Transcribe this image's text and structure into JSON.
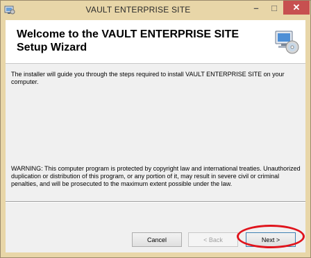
{
  "window": {
    "title": "VAULT ENTERPRISE SITE",
    "minimize_glyph": "–",
    "maximize_glyph": "□",
    "close_glyph": "✕"
  },
  "header": {
    "title": "Welcome to the VAULT ENTERPRISE SITE Setup Wizard",
    "icon": "computer-cd-icon"
  },
  "body": {
    "intro": "The installer will guide you through the steps required to install VAULT ENTERPRISE SITE on your computer.",
    "warning": "WARNING: This computer program is protected by copyright law and international treaties. Unauthorized duplication or distribution of this program, or any portion of it, may result in severe civil or criminal penalties, and will be prosecuted to the maximum extent possible under the law."
  },
  "buttons": {
    "cancel": "Cancel",
    "back": "< Back",
    "next": "Next >"
  },
  "colors": {
    "title_bar": "#e8d6a8",
    "close_button": "#c75050",
    "highlight": "#e0141c"
  }
}
